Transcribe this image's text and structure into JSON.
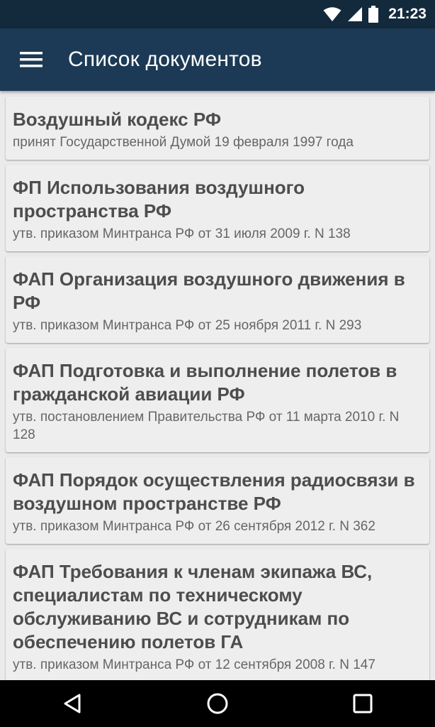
{
  "status_bar": {
    "time": "21:23",
    "icons": [
      "wifi-icon",
      "cell-signal-icon",
      "battery-icon"
    ]
  },
  "app_bar": {
    "title": "Список документов",
    "menu_icon": "hamburger-menu-icon"
  },
  "documents": [
    {
      "title": "Воздушный кодекс РФ",
      "subtitle": "принят Государственной Думой 19 февраля 1997 года"
    },
    {
      "title": "ФП Использования воздушного пространства РФ",
      "subtitle": "утв. приказом Минтранса РФ от 31 июля 2009 г. N 138"
    },
    {
      "title": "ФАП Организация воздушного движения в РФ",
      "subtitle": "утв. приказом Минтранса РФ от 25 ноября 2011 г. N 293"
    },
    {
      "title": "ФАП Подготовка и выполнение полетов в гражданской авиации РФ",
      "subtitle": "утв. постановлением Правительства РФ от 11 марта 2010 г. N 128"
    },
    {
      "title": "ФАП Порядок осуществления радиосвязи в воздушном пространстве РФ",
      "subtitle": "утв. приказом Минтранса РФ от 26 сентября 2012 г. N 362"
    },
    {
      "title": "ФАП Требования к членам экипажа ВС, специалистам по техническому обслуживанию ВС и сотрудникам по обеспечению полетов ГА",
      "subtitle": "утв. приказом Минтранса РФ от 12 сентября 2008 г. N 147"
    }
  ],
  "nav_bar": {
    "icons": [
      "back-icon",
      "home-icon",
      "recents-icon"
    ]
  },
  "colors": {
    "status_bar_bg": "#13293c",
    "app_bar_bg": "#1c3a55",
    "card_bg": "#eeeeee",
    "list_bg": "#ebebeb"
  }
}
